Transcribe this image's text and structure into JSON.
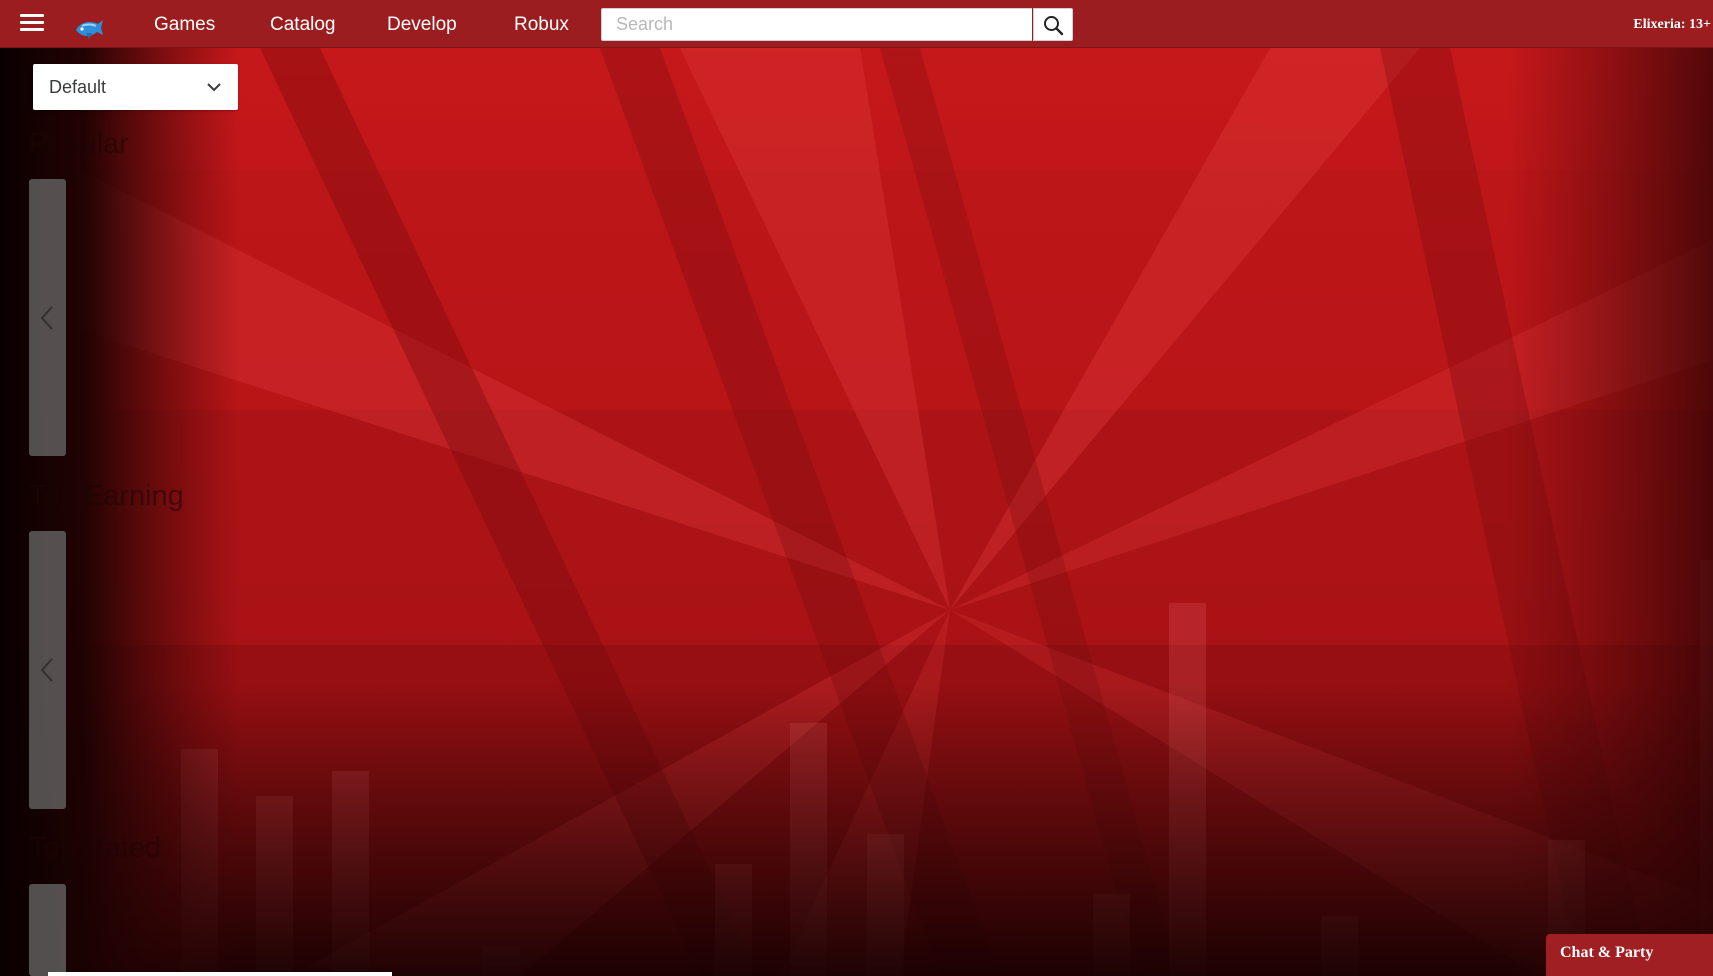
{
  "topbar": {
    "menu_icon": "hamburger-menu-icon",
    "logo_icon": "blue-fish-logo-icon",
    "nav": {
      "games": "Games",
      "catalog": "Catalog",
      "develop": "Develop",
      "robux": "Robux"
    },
    "search": {
      "placeholder": "Search",
      "value": "",
      "icon": "search-icon"
    },
    "user": "Elixeria: 13+"
  },
  "sort": {
    "selected": "Default",
    "icon": "chevron-down-icon"
  },
  "sections": {
    "popular": "Popular",
    "top_earning": "Top Earning",
    "top_rated": "Top Rated"
  },
  "carousel_arrow_icon": "chevron-left-icon",
  "chat": {
    "label": "Chat & Party"
  },
  "colors": {
    "topbar": "#9b1d1f",
    "background_red": "#c4181b",
    "chat_button": "#a01f23"
  }
}
